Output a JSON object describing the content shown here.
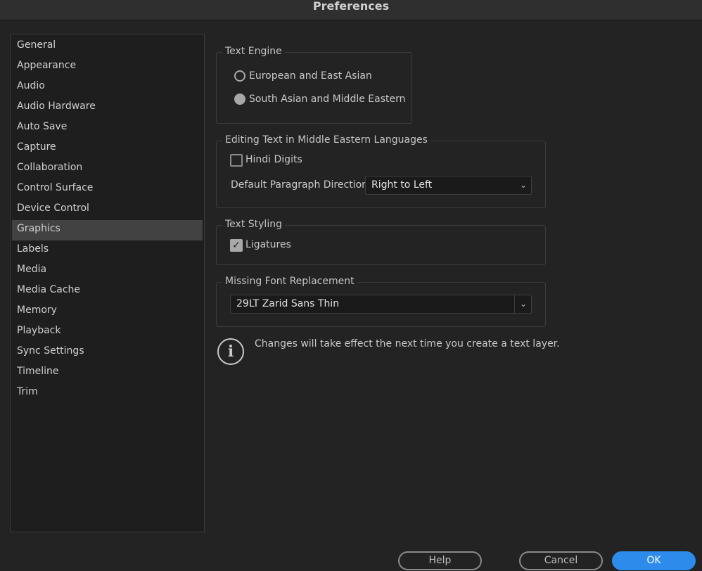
{
  "window": {
    "title": "Preferences"
  },
  "sidebar": {
    "items": [
      {
        "label": "General"
      },
      {
        "label": "Appearance"
      },
      {
        "label": "Audio"
      },
      {
        "label": "Audio Hardware"
      },
      {
        "label": "Auto Save"
      },
      {
        "label": "Capture"
      },
      {
        "label": "Collaboration"
      },
      {
        "label": "Control Surface"
      },
      {
        "label": "Device Control"
      },
      {
        "label": "Graphics",
        "selected": true
      },
      {
        "label": "Labels"
      },
      {
        "label": "Media"
      },
      {
        "label": "Media Cache"
      },
      {
        "label": "Memory"
      },
      {
        "label": "Playback"
      },
      {
        "label": "Sync Settings"
      },
      {
        "label": "Timeline"
      },
      {
        "label": "Trim"
      }
    ]
  },
  "text_engine": {
    "title": "Text Engine",
    "options": [
      {
        "label": "European and East Asian",
        "selected": false
      },
      {
        "label": "South Asian and Middle Eastern",
        "selected": true
      }
    ]
  },
  "editing": {
    "title": "Editing Text in Middle Eastern Languages",
    "hindi_digits": {
      "label": "Hindi Digits",
      "checked": false
    },
    "direction_label": "Default Paragraph Direction:",
    "direction_value": "Right to Left"
  },
  "styling": {
    "title": "Text Styling",
    "ligatures": {
      "label": "Ligatures",
      "checked": true
    }
  },
  "missing_font": {
    "title": "Missing Font Replacement",
    "value": "29LT Zarid Sans Thin"
  },
  "info": {
    "icon": "info-icon",
    "text": "Changes will take effect the next time you create a text layer."
  },
  "buttons": {
    "help": "Help",
    "cancel": "Cancel",
    "ok": "OK"
  },
  "colors": {
    "accent": "#2d8ceb",
    "background": "#232323"
  }
}
